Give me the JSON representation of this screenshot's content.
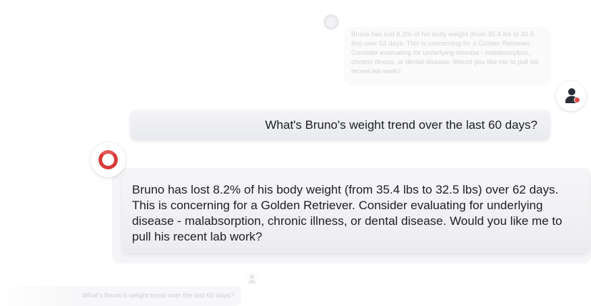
{
  "conversation": {
    "faded_bot_reply": "Bruno has lost 8.2% of his body weight (from 35.4 lbs to 32.5 lbs) over 62 days. This is concerning for a Golden Retriever. Consider evaluating for underlying disease - malabsorption, chronic illness, or dental disease. Would you like me to pull his recent lab work?",
    "user_message": "What's Bruno's weight trend over the last 60 days?",
    "bot_reply": "Bruno has lost 8.2% of his body weight (from 35.4 lbs to 32.5 lbs) over 62 days. This is concerning for a Golden Retriever. Consider evaluating for underlying disease - malabsorption, chronic illness, or dental disease. Would you like me to pull his recent lab work?",
    "faded_user_message": "What's Bruno's weight trend over the last 60 days?"
  },
  "icons": {
    "user_avatar": "user-with-badge-icon",
    "bot_avatar": "ring-logo-icon"
  },
  "colors": {
    "brand_red": "#d83a3a",
    "bubble_bg": "#efeff2",
    "text": "#1c1e25"
  }
}
